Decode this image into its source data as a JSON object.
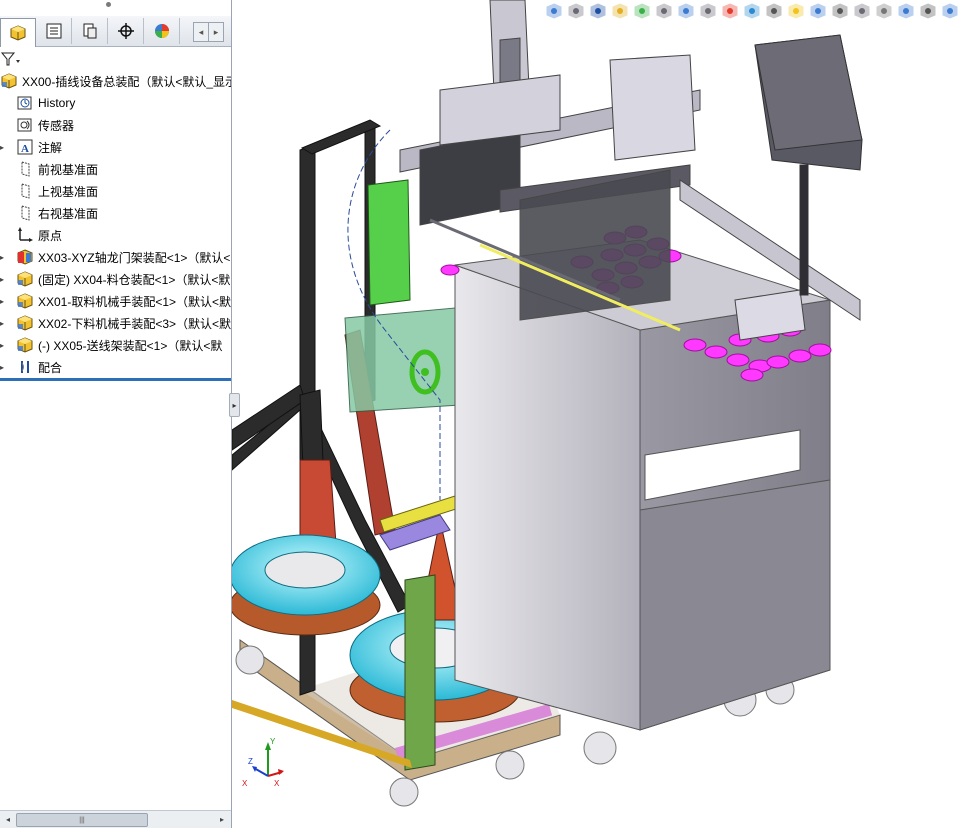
{
  "pane": {
    "tabs": [
      {
        "icon": "feature-manager-icon",
        "active": true
      },
      {
        "icon": "property-manager-icon",
        "active": false
      },
      {
        "icon": "configuration-manager-icon",
        "active": false
      },
      {
        "icon": "dimxpert-icon",
        "active": false
      },
      {
        "icon": "display-manager-icon",
        "active": false
      }
    ],
    "filter_icon": "filter-icon",
    "tree": [
      {
        "label": "XX00-插线设备总装配（默认<默认_显示",
        "icon": "assembly-icon",
        "expander": false,
        "level": 0
      },
      {
        "label": "History",
        "icon": "history-icon",
        "expander": false,
        "level": 1
      },
      {
        "label": "传感器",
        "icon": "sensor-icon",
        "expander": false,
        "level": 1
      },
      {
        "label": "注解",
        "icon": "annotation-icon",
        "expander": true,
        "level": 1
      },
      {
        "label": "前视基准面",
        "icon": "plane-icon",
        "expander": false,
        "level": 1
      },
      {
        "label": "上视基准面",
        "icon": "plane-icon",
        "expander": false,
        "level": 1
      },
      {
        "label": "右视基准面",
        "icon": "plane-icon",
        "expander": false,
        "level": 1
      },
      {
        "label": "原点",
        "icon": "origin-icon",
        "expander": false,
        "level": 1
      },
      {
        "label": "XX03-XYZ轴龙门架装配<1>（默认<",
        "icon": "subassembly-warning-icon",
        "expander": true,
        "level": 1
      },
      {
        "label": "(固定) XX04-料仓装配<1>（默认<默",
        "icon": "subassembly-icon",
        "expander": true,
        "level": 1
      },
      {
        "label": "XX01-取料机械手装配<1>（默认<默",
        "icon": "subassembly-icon",
        "expander": true,
        "level": 1
      },
      {
        "label": "XX02-下料机械手装配<3>（默认<默",
        "icon": "subassembly-icon",
        "expander": true,
        "level": 1
      },
      {
        "label": "(-) XX05-送线架装配<1>（默认<默",
        "icon": "subassembly-icon",
        "expander": true,
        "level": 1
      },
      {
        "label": "配合",
        "icon": "mates-icon",
        "expander": true,
        "level": 1
      }
    ],
    "scrollbar_grip": "|||"
  },
  "view_toolbar": [
    "zoom-to-fit-icon",
    "zoom-to-area-icon",
    "previous-view-icon",
    "section-view-icon",
    "dynamic-annotation-icon",
    "view-orientation-icon",
    "display-style-icon",
    "hide-show-icon",
    "edit-appearance-icon",
    "apply-scene-icon",
    "view-settings-icon",
    "lights-icon",
    "rotate-icon",
    "pan-icon",
    "render-icon",
    "camera-icon",
    "perspective-icon",
    "shadows-icon",
    "display-pane-icon"
  ],
  "triad": {
    "x": "X",
    "y": "Y",
    "z": "Z"
  },
  "colors": {
    "selection_blue": "#2d6fb4",
    "frame_dark": "#2b2b2b",
    "cabinet_gray": "#a9a7b1",
    "magenta_trays": "#ff39ff",
    "ring_cyan": "#49d9f0",
    "ring_orange": "#e0552b",
    "rail_green": "#39c53b",
    "rail_yellow": "#d7d23a"
  }
}
